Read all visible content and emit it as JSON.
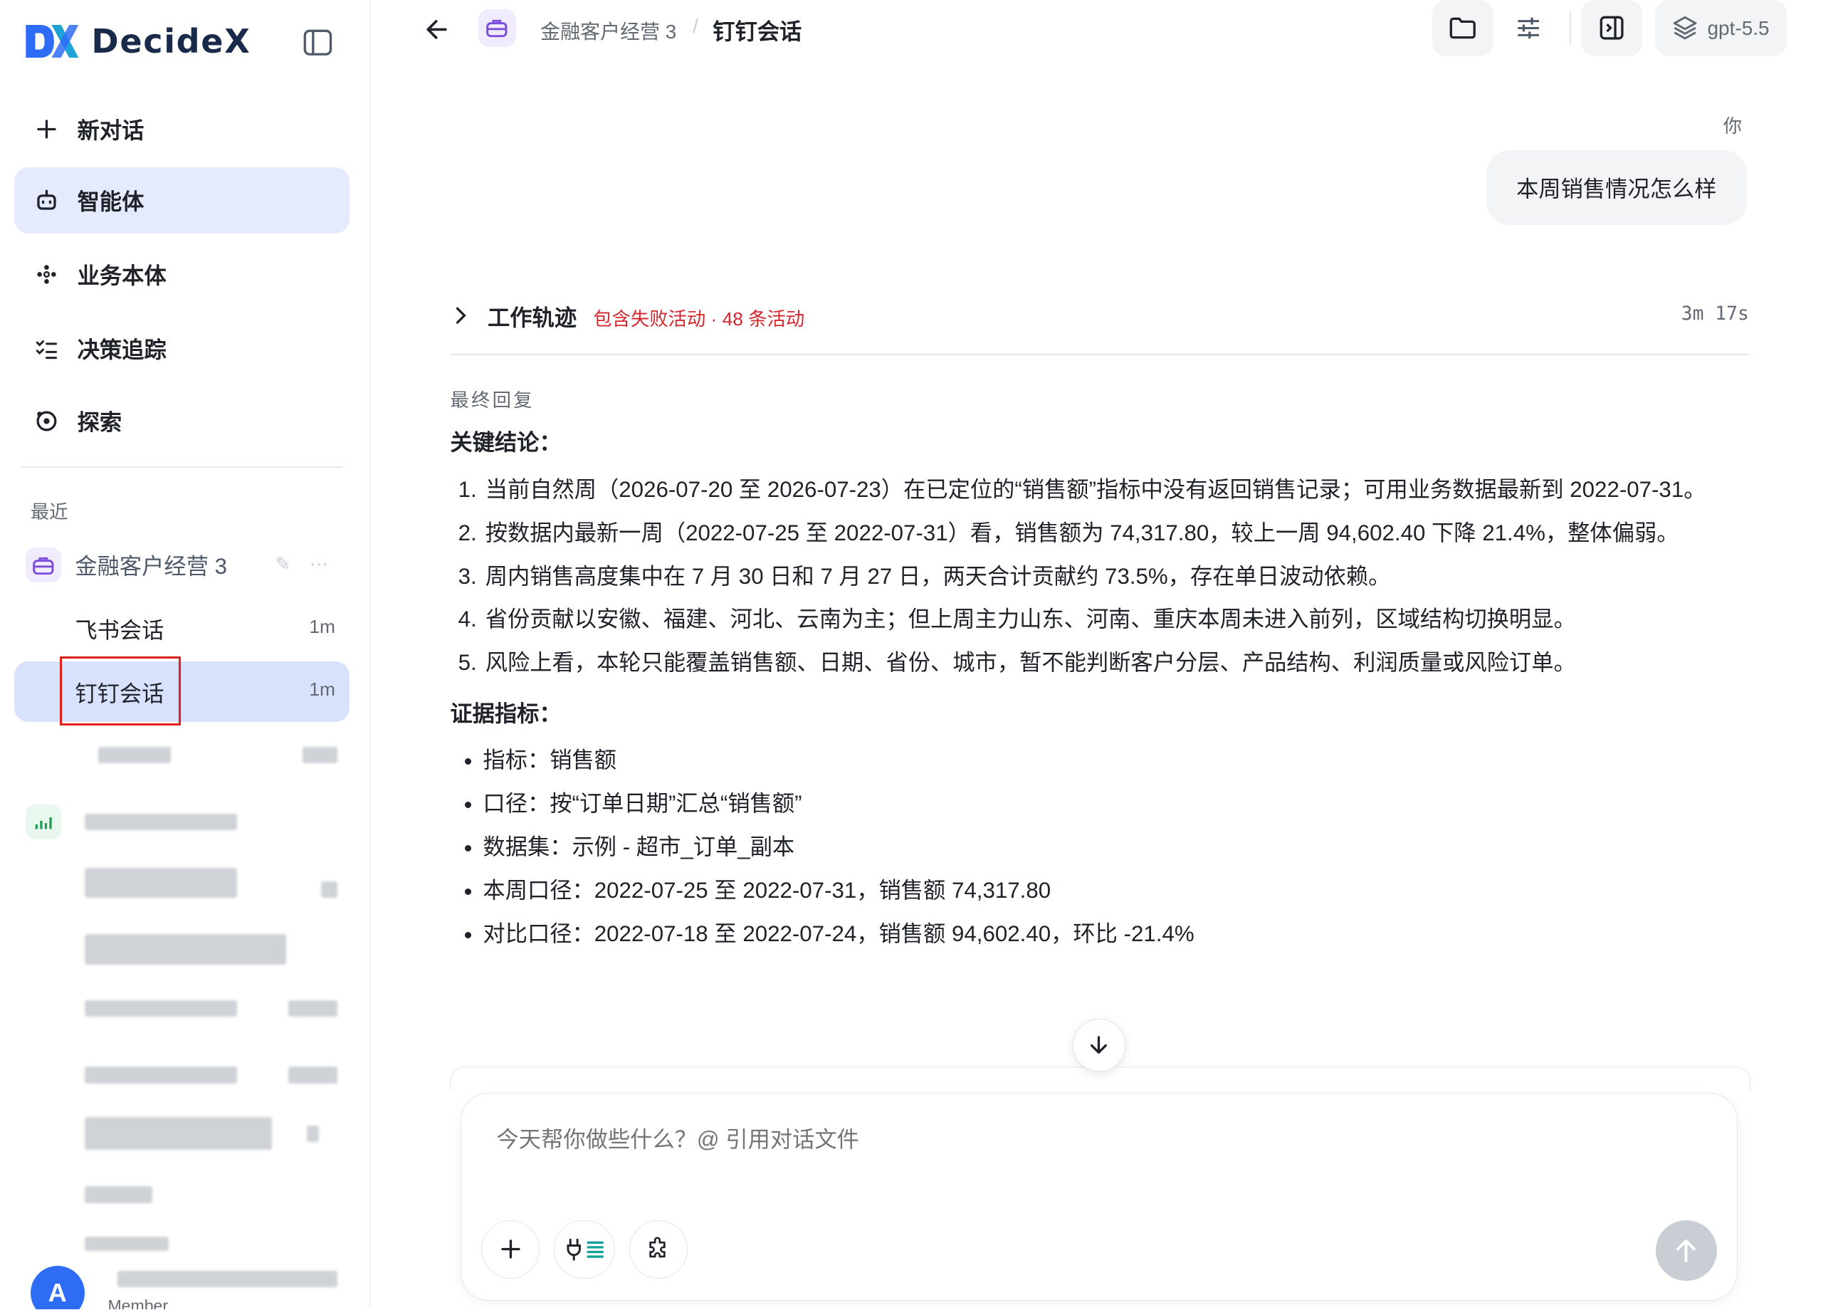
{
  "app": {
    "name": "DecideX"
  },
  "nav": [
    {
      "label": "新对话",
      "icon": "plus-icon"
    },
    {
      "label": "智能体",
      "icon": "robot-icon"
    },
    {
      "label": "业务本体",
      "icon": "network-icon"
    },
    {
      "label": "决策追踪",
      "icon": "checklist-icon"
    },
    {
      "label": "探索",
      "icon": "explore-icon"
    }
  ],
  "recent": {
    "label": "最近",
    "group": {
      "title": "金融客户经营 3"
    },
    "items": [
      {
        "label": "飞书会话",
        "time": "1m"
      },
      {
        "label": "钉钉会话",
        "time": "1m"
      }
    ]
  },
  "user": {
    "initial": "A",
    "role": "Member"
  },
  "header": {
    "breadcrumb_agent": "金融客户经营 3",
    "breadcrumb_sep": "/",
    "title": "钉钉会话",
    "model": "gpt-5.5"
  },
  "chat": {
    "user_label": "你",
    "user_message": "本周销售情况怎么样",
    "trace": {
      "title": "工作轨迹",
      "status": "包含失败活动 · 48 条活动",
      "duration": "3m 17s"
    },
    "final_label": "最终回复",
    "conclusion_heading": "关键结论：",
    "conclusions": [
      "当前自然周（2026-07-20 至 2026-07-23）在已定位的“销售额”指标中没有返回销售记录；可用业务数据最新到 2022-07-31。",
      "按数据内最新一周（2022-07-25 至 2022-07-31）看，销售额为 74,317.80，较上一周 94,602.40 下降 21.4%，整体偏弱。",
      "周内销售高度集中在 7 月 30 日和 7 月 27 日，两天合计贡献约 73.5%，存在单日波动依赖。",
      "省份贡献以安徽、福建、河北、云南为主；但上周主力山东、河南、重庆本周未进入前列，区域结构切换明显。",
      "风险上看，本轮只能覆盖销售额、日期、省份、城市，暂不能判断客户分层、产品结构、利润质量或风险订单。"
    ],
    "evidence_heading": "证据指标：",
    "evidence": [
      "指标：销售额",
      "口径：按“订单日期”汇总“销售额”",
      "数据集：示例 - 超市_订单_副本",
      "本周口径：2022-07-25 至 2022-07-31，销售额 74,317.80",
      "对比口径：2022-07-18 至 2022-07-24，销售额 94,602.40，环比 -21.4%"
    ]
  },
  "composer": {
    "placeholder": "今天帮你做些什么？@ 引用对话文件"
  },
  "colors": {
    "accent": "#2f6cf6",
    "active_bg": "#e5ebfd",
    "selected_bg": "#d8e2fc",
    "error": "#d4272e"
  }
}
